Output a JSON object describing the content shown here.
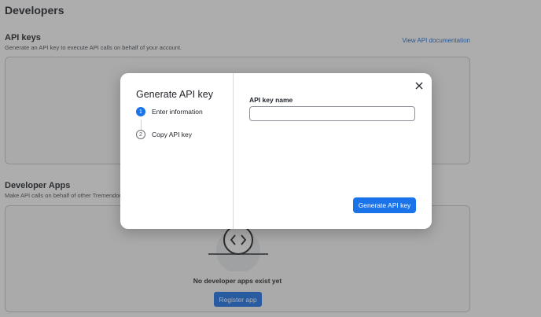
{
  "page": {
    "title": "Developers"
  },
  "api_keys": {
    "title": "API keys",
    "description": "Generate an API key to execute API calls on behalf of your account.",
    "doc_link": "View API documentation"
  },
  "developer_apps": {
    "title": "Developer Apps",
    "description": "Make API calls on behalf of other Tremendous",
    "empty_text": "No developer apps exist yet",
    "register_label": "Register app"
  },
  "modal": {
    "title": "Generate API key",
    "steps": [
      {
        "number": "1",
        "label": "Enter information",
        "active": true
      },
      {
        "number": "2",
        "label": "Copy API key",
        "active": false
      }
    ],
    "field_label": "API key name",
    "field_value": "",
    "generate_label": "Generate API key"
  },
  "colors": {
    "accent": "#1a73e8",
    "link": "#1a6fd1",
    "overlay": "rgba(60,60,60,0.42)"
  },
  "icons": {
    "close": "close-icon",
    "apps": "code-brackets-icon"
  }
}
